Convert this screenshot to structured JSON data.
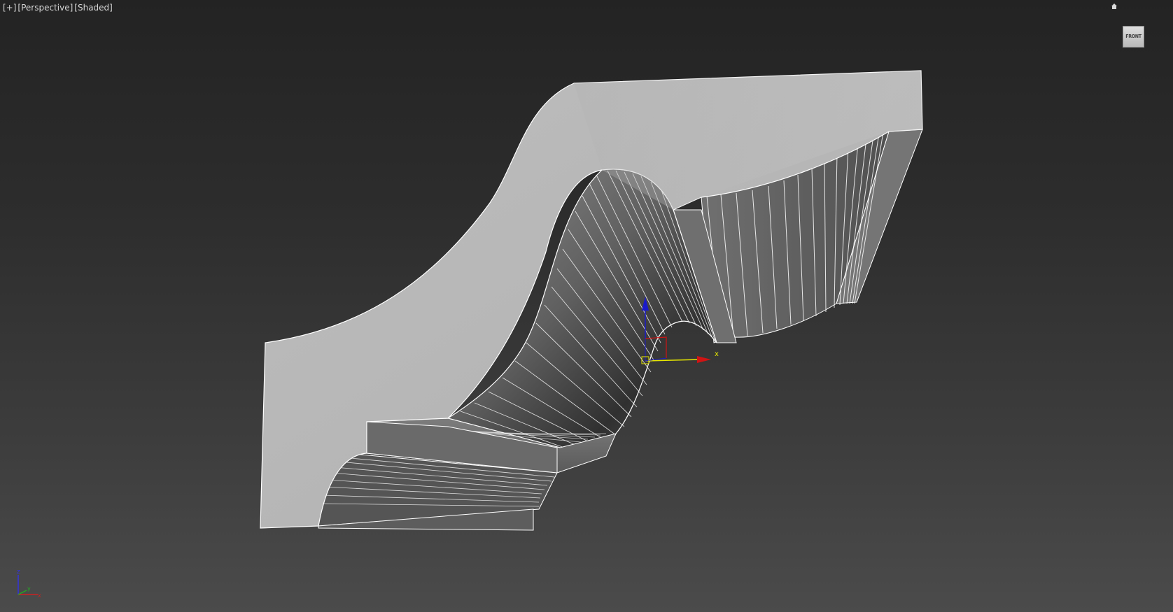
{
  "viewport": {
    "labels": {
      "plus": "[+]",
      "view": "[Perspective]",
      "shading": "[Shaded]"
    },
    "viewcube": {
      "face": "FRONT"
    },
    "gizmo": {
      "x_label": "x"
    },
    "tripod": {
      "z_label": "z",
      "y_label": "y",
      "x_label": "x"
    },
    "colors": {
      "background_top": "#232323",
      "background_bottom": "#4b4b4b",
      "object_face": "#c0c0c0",
      "edge_lines": "#ffffff",
      "gizmo_x": "#d01414",
      "gizmo_y": "#e8e800",
      "gizmo_z": "#1a1acc"
    },
    "icons": [
      "home-icon",
      "viewcube-icon"
    ]
  }
}
